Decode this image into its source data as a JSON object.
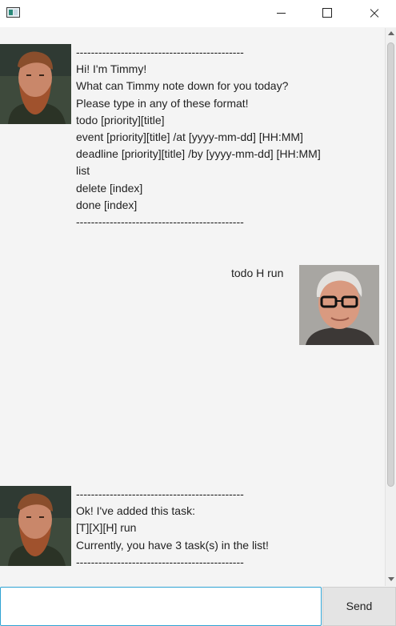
{
  "window": {
    "title": "",
    "icon": "app-window-icon"
  },
  "chat": {
    "messages": [
      {
        "sender": "bot",
        "avatar": "bearded-man-avatar",
        "lines": [
          "---------------------------------------------",
          "Hi! I'm Timmy!",
          "What can Timmy note down for you today?",
          "Please type in any of these format!",
          "todo [priority][title]",
          "event [priority][title] /at [yyyy-mm-dd] [HH:MM]",
          "deadline [priority][title] /by [yyyy-mm-dd] [HH:MM]",
          "list",
          "delete [index]",
          "done [index]",
          "---------------------------------------------"
        ]
      },
      {
        "sender": "user",
        "avatar": "older-man-glasses-avatar",
        "lines": [
          "todo H run"
        ]
      },
      {
        "sender": "bot",
        "avatar": "bearded-man-avatar",
        "lines": [
          "---------------------------------------------",
          "Ok! I've added this task:",
          "[T][X][H] run",
          "Currently, you have 3 task(s) in the list!",
          "---------------------------------------------"
        ]
      }
    ]
  },
  "input": {
    "value": "",
    "placeholder": ""
  },
  "send_button": {
    "label": "Send"
  },
  "colors": {
    "background": "#f4f4f4",
    "input_border": "#2fa3d3",
    "send_button_bg": "#e4e4e4"
  }
}
